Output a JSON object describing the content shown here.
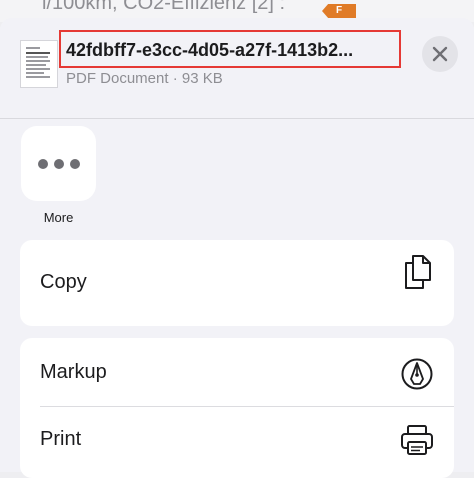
{
  "background": {
    "peek_text": "l/100km, CO2-Effizienz [2] :",
    "badge": "F"
  },
  "share_sheet": {
    "file_title": "42fdbff7-e3cc-4d05-a27f-1413b2...",
    "file_subtitle": "PDF Document · 93 KB",
    "icons": {
      "thumbnail": "pdf-thumbnail-icon",
      "close": "close-icon",
      "more": "ellipsis-icon",
      "copy": "copy-icon",
      "markup": "markup-pen-icon",
      "print": "printer-icon"
    },
    "more_label": "More",
    "actions": [
      {
        "label": "Copy"
      },
      {
        "label": "Markup"
      },
      {
        "label": "Print"
      }
    ]
  },
  "colors": {
    "highlight_border": "#e53935",
    "badge": "#e07b27"
  }
}
